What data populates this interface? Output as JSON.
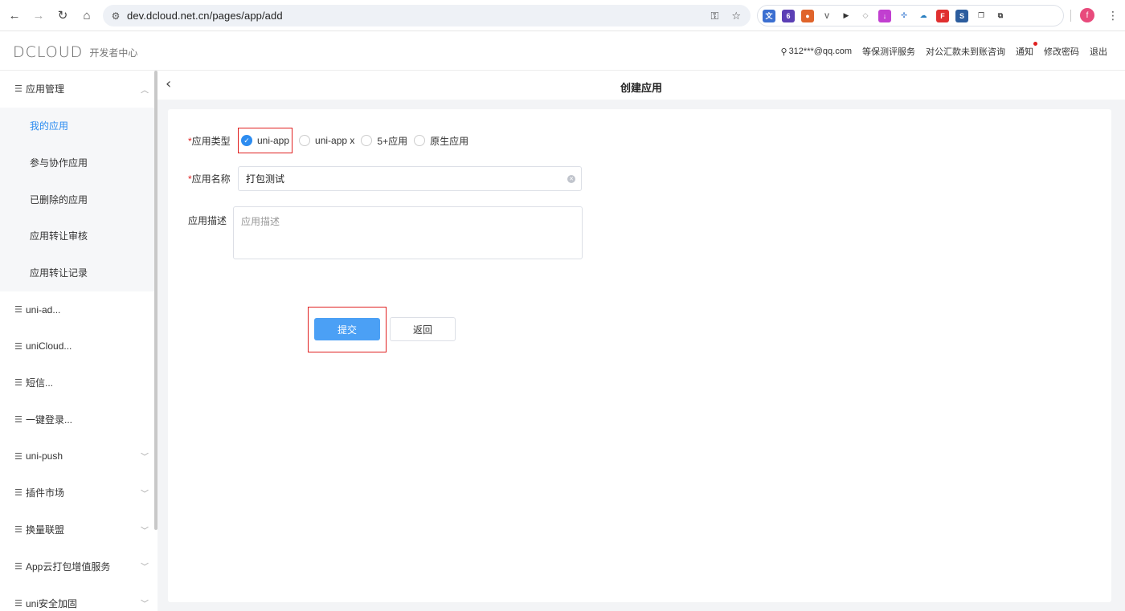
{
  "browser": {
    "url": "dev.dcloud.net.cn/pages/app/add",
    "profile_initial": "f"
  },
  "header": {
    "logo_text": "DCLOUD",
    "logo_sub": "开发者中心",
    "user": "312***@qq.com",
    "links": [
      "等保测评服务",
      "对公汇款未到账咨询",
      "通知",
      "修改密码",
      "退出"
    ]
  },
  "sidebar": {
    "groups": [
      {
        "label": "应用管理",
        "expanded": true,
        "children": [
          "我的应用",
          "参与协作应用",
          "已删除的应用",
          "应用转让审核",
          "应用转让记录"
        ]
      },
      {
        "label": "uni-ad..."
      },
      {
        "label": "uniCloud..."
      },
      {
        "label": "短信..."
      },
      {
        "label": "一键登录..."
      },
      {
        "label": "uni-push"
      },
      {
        "label": "插件市场"
      },
      {
        "label": "换量联盟"
      },
      {
        "label": "App云打包增值服务"
      },
      {
        "label": "uni安全加固"
      }
    ]
  },
  "page": {
    "title": "创建应用",
    "form": {
      "type_label": "应用类型",
      "type_options": [
        "uni-app",
        "uni-app x",
        "5+应用",
        "原生应用"
      ],
      "type_selected": "uni-app",
      "name_label": "应用名称",
      "name_value": "打包测试",
      "desc_label": "应用描述",
      "desc_placeholder": "应用描述",
      "submit_label": "提交",
      "back_label": "返回"
    }
  },
  "colors": {
    "primary": "#4ba0f5",
    "active": "#2d8cf0",
    "required": "#e02020"
  }
}
